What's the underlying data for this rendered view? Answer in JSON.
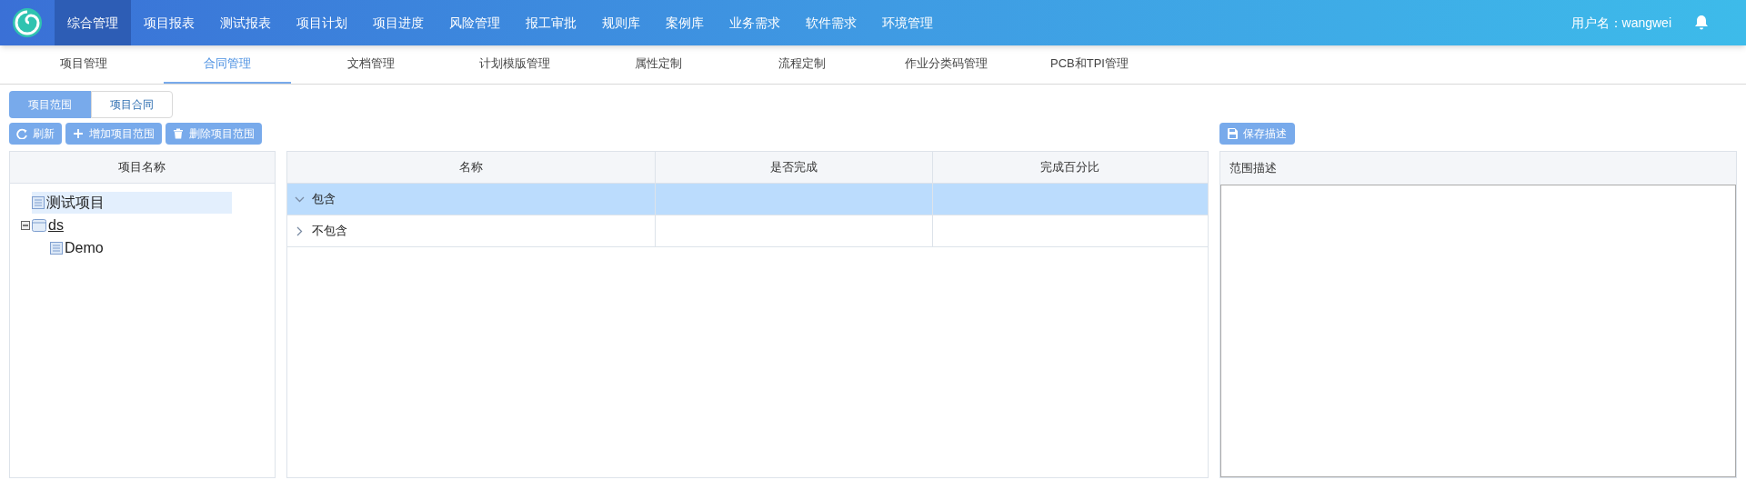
{
  "nav": [
    {
      "label": "综合管理",
      "selected": true
    },
    {
      "label": "项目报表",
      "selected": false
    },
    {
      "label": "测试报表",
      "selected": false
    },
    {
      "label": "项目计划",
      "selected": false
    },
    {
      "label": "项目进度",
      "selected": false
    },
    {
      "label": "风险管理",
      "selected": false
    },
    {
      "label": "报工审批",
      "selected": false
    },
    {
      "label": "规则库",
      "selected": false
    },
    {
      "label": "案例库",
      "selected": false
    },
    {
      "label": "业务需求",
      "selected": false
    },
    {
      "label": "软件需求",
      "selected": false
    },
    {
      "label": "环境管理",
      "selected": false
    }
  ],
  "user": "用户名：wangwei",
  "subtabs": [
    {
      "label": "项目管理",
      "selected": false
    },
    {
      "label": "合同管理",
      "selected": true
    },
    {
      "label": "文档管理",
      "selected": false
    },
    {
      "label": "计划模版管理",
      "selected": false
    },
    {
      "label": "属性定制",
      "selected": false
    },
    {
      "label": "流程定制",
      "selected": false
    },
    {
      "label": "作业分类码管理",
      "selected": false
    },
    {
      "label": "PCB和TPI管理",
      "selected": false
    }
  ],
  "toggle": [
    {
      "label": "项目范围",
      "selected": true
    },
    {
      "label": "项目合同",
      "selected": false
    }
  ],
  "toolbar": [
    {
      "kind": "refresh",
      "label": "刷新"
    },
    {
      "kind": "add",
      "label": "增加项目范围"
    },
    {
      "kind": "delete",
      "label": "删除项目范围"
    }
  ],
  "tree": {
    "header": "项目名称",
    "items": [
      {
        "label": "测试项目",
        "selected": true
      },
      {
        "label": "ds",
        "selected": false,
        "expanded": true,
        "children": [
          {
            "label": "Demo",
            "selected": false
          }
        ]
      }
    ]
  },
  "table": {
    "columns": [
      "名称",
      "是否完成",
      "完成百分比"
    ],
    "rows": [
      {
        "name": "包含",
        "expanded": true,
        "selected": true
      },
      {
        "name": "不包含",
        "expanded": false,
        "selected": false
      }
    ]
  },
  "description": {
    "button": "保存描述",
    "header": "范围描述"
  }
}
